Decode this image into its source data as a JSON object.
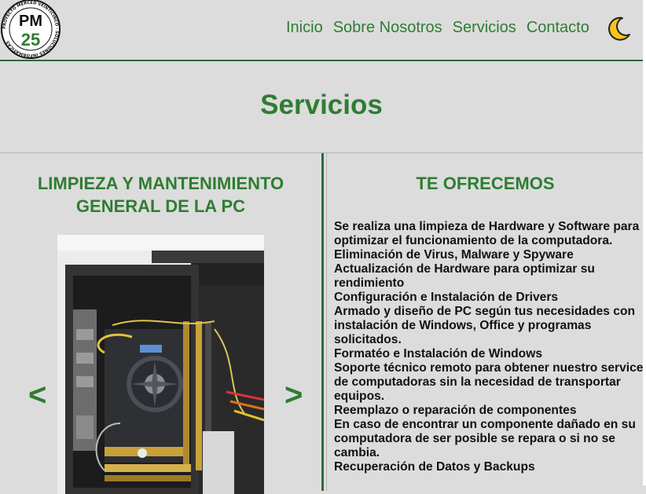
{
  "logo": {
    "initials_top": "PM",
    "initials_bottom": "25",
    "ring_text": "PROYECTO MERCED VEINTICINCO · SOLUCIONES INFORMATICAS"
  },
  "nav": {
    "items": [
      {
        "label": "Inicio"
      },
      {
        "label": "Sobre Nosotros"
      },
      {
        "label": "Servicios"
      },
      {
        "label": "Contacto"
      }
    ],
    "theme_toggle_icon": "moon-icon"
  },
  "page": {
    "title": "Servicios"
  },
  "carousel": {
    "heading": "LIMPIEZA Y MANTENIMIENTO GENERAL DE LA PC",
    "prev_label": "<",
    "next_label": ">",
    "image_subject": "pc-motherboard-photo"
  },
  "offer": {
    "heading": "TE OFRECEMOS",
    "lines": [
      "Se realiza una limpieza de Hardware y Software para optimizar el funcionamiento de la computadora.",
      "Eliminación de Virus, Malware y Spyware",
      "Actualización de Hardware para optimizar su rendimiento",
      "Configuración e Instalación de Drivers",
      "Armado y diseño de PC según tus necesidades con instalación de Windows, Office y programas solicitados.",
      "Formatéo e Instalación de Windows",
      "Soporte técnico remoto para obtener nuestro service de computadoras sin la necesidad de transportar equipos.",
      "Reemplazo o reparación de componentes",
      "En caso de encontrar un componente dañado en su computadora de ser posible se repara o si no se cambia.",
      "Recuperación de Datos y Backups"
    ]
  },
  "colors": {
    "accent": "#2e7d32",
    "background": "#dcdcdc",
    "divider": "#2e6b33",
    "moon": "#f5c518"
  }
}
